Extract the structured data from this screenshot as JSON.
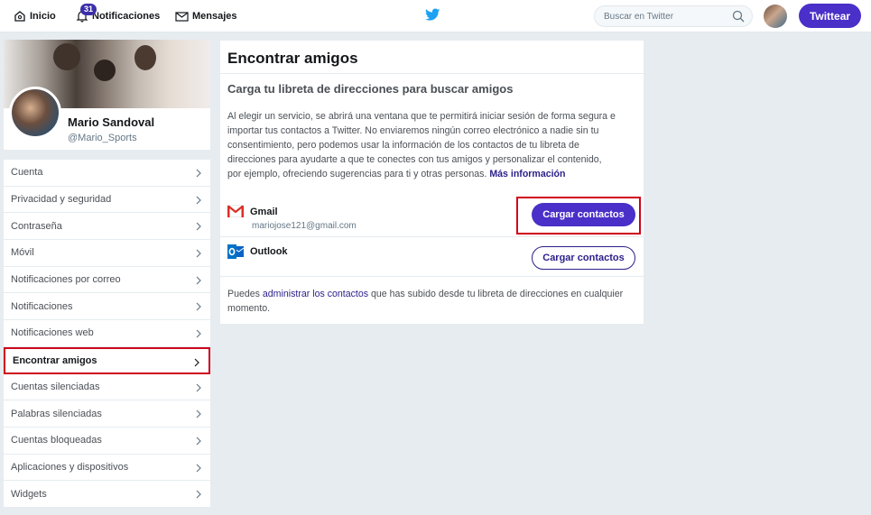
{
  "nav": {
    "home_label": "Inicio",
    "notifications_label": "Notificaciones",
    "notifications_count": "31",
    "messages_label": "Mensajes",
    "search_placeholder": "Buscar en Twitter",
    "tweet_button": "Twittear"
  },
  "profile": {
    "name": "Mario Sandoval",
    "handle": "@Mario_Sports"
  },
  "menu": {
    "items": [
      {
        "label": "Cuenta"
      },
      {
        "label": "Privacidad y seguridad"
      },
      {
        "label": "Contraseña"
      },
      {
        "label": "Móvil"
      },
      {
        "label": "Notificaciones por correo"
      },
      {
        "label": "Notificaciones"
      },
      {
        "label": "Notificaciones web"
      },
      {
        "label": "Encontrar amigos"
      },
      {
        "label": "Cuentas silenciadas"
      },
      {
        "label": "Palabras silenciadas"
      },
      {
        "label": "Cuentas bloqueadas"
      },
      {
        "label": "Aplicaciones y dispositivos"
      },
      {
        "label": "Widgets"
      }
    ]
  },
  "panel": {
    "title": "Encontrar amigos",
    "subtitle": "Carga tu libreta de direcciones para buscar amigos",
    "description": "Al elegir un servicio, se abrirá una ventana que te permitirá iniciar sesión de forma segura e importar tus contactos a Twitter. No enviaremos ningún correo electrónico a nadie sin tu consentimiento, pero podemos usar la información de los contactos de tu libreta de direcciones para ayudarte a que te conectes con tus amigos y personalizar el contenido, por ejemplo, ofreciendo sugerencias para ti y otras personas.",
    "more_info_link": "Más información",
    "services": {
      "gmail": {
        "name": "Gmail",
        "email": "mariojose121@gmail.com",
        "button": "Cargar contactos"
      },
      "outlook": {
        "name": "Outlook",
        "button": "Cargar contactos"
      }
    },
    "footer_prefix": "Puedes",
    "footer_link": "administrar los contactos",
    "footer_suffix": "que has subido desde tu libreta de direcciones en cualquier momento."
  },
  "colors": {
    "accent": "#4a2fc8",
    "highlight": "#d0021b",
    "twitter_blue": "#1da1f2"
  }
}
